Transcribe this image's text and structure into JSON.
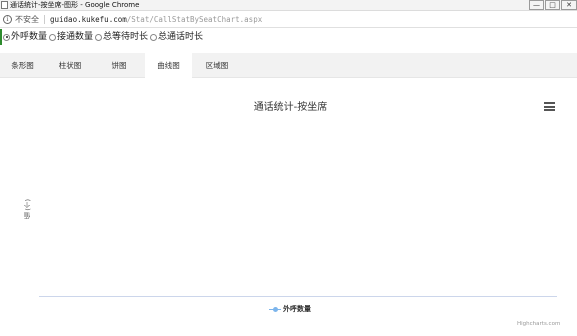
{
  "window": {
    "title": "通话统计-按坐席-图形 - Google Chrome",
    "controls": [
      "—",
      "□",
      "✕"
    ]
  },
  "address_bar": {
    "security_text": "不安全",
    "url_host": "guidao.kukefu.com",
    "url_path": "/Stat/CallStatBySeatChart.aspx"
  },
  "filters": {
    "options": [
      {
        "label": "外呼数量",
        "checked": true
      },
      {
        "label": "接通数量",
        "checked": false
      },
      {
        "label": "总等待时长",
        "checked": false
      },
      {
        "label": "总通话时长",
        "checked": false
      }
    ]
  },
  "tabs": [
    {
      "label": "条形图",
      "active": false
    },
    {
      "label": "柱状图",
      "active": false
    },
    {
      "label": "饼图",
      "active": false
    },
    {
      "label": "曲线图",
      "active": true
    },
    {
      "label": "区域图",
      "active": false
    }
  ],
  "chart_data": {
    "type": "line",
    "title": "通话统计-按坐席",
    "ylabel": "值 (个)",
    "xlabel": "",
    "categories": [],
    "series": [
      {
        "name": "外呼数量",
        "values": [],
        "color": "#7cb5ec"
      }
    ],
    "legend_position": "bottom-center",
    "credits": "Highcharts.com"
  }
}
